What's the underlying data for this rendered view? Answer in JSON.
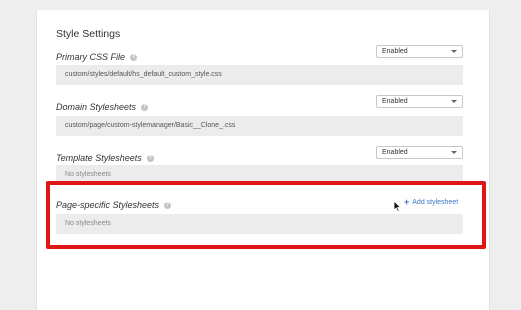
{
  "section": {
    "title": "Style Settings"
  },
  "primary_css": {
    "label": "Primary CSS File",
    "status": "Enabled",
    "value": "custom/styles/default/hs_default_custom_style.css"
  },
  "domain_stylesheets": {
    "label": "Domain Stylesheets",
    "status": "Enabled",
    "value": "custom/page/custom-stylemanager/Basic__Clone_.css"
  },
  "template_stylesheets": {
    "label": "Template Stylesheets",
    "status": "Enabled",
    "empty_text": "No stylesheets"
  },
  "page_specific_stylesheets": {
    "label": "Page-specific Stylesheets",
    "add_label": "Add stylesheet",
    "empty_text": "No stylesheets"
  },
  "icons": {
    "help": "question-circle-icon",
    "dropdown": "chevron-down-icon",
    "add": "plus-icon",
    "cursor": "mouse-pointer-icon"
  },
  "colors": {
    "highlight": "#e01515",
    "link": "#3a78c2",
    "value_background": "#ececec",
    "page_background": "#eeeeee"
  }
}
